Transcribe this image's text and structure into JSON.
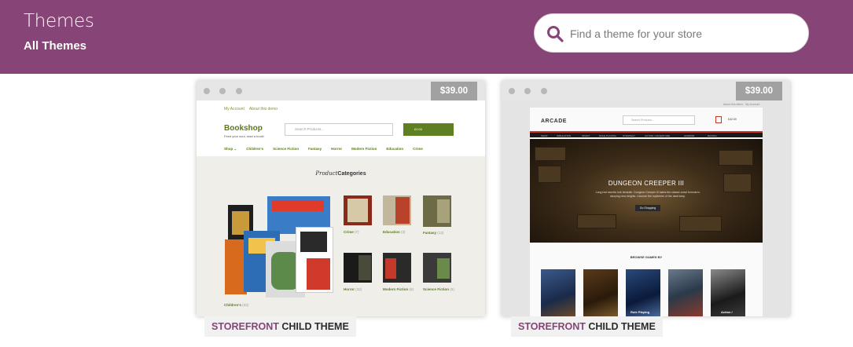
{
  "header": {
    "title": "Themes",
    "subtitle": "All Themes",
    "search_placeholder": "Find a theme for your store",
    "background": "#874476"
  },
  "cards": [
    {
      "price": "$39.00",
      "label_brand": "STOREFRONT",
      "label_rest": " CHILD THEME",
      "preview": {
        "top_links": [
          "My Account",
          "About this demo"
        ],
        "logo": "Bookshop",
        "tagline": "Feed your soul, read a book!",
        "search_placeholder": "Search Products...",
        "cart": "£0.00",
        "nav": [
          "Shop ⌄",
          "Children's",
          "Science Fiction",
          "Fantasy",
          "Horror",
          "Modern Fiction",
          "Education",
          "Crime"
        ],
        "heading_italic": "Product",
        "heading_bold": "Categories",
        "categories": [
          {
            "name": "Crime",
            "count": "(7)"
          },
          {
            "name": "Education",
            "count": "(3)"
          },
          {
            "name": "Fantasy",
            "count": "(13)"
          },
          {
            "name": "Horror",
            "count": "(32)"
          },
          {
            "name": "Modern Fiction",
            "count": "(6)"
          },
          {
            "name": "Science Fiction",
            "count": "(5)"
          },
          {
            "name": "Children's",
            "count": "(33)"
          }
        ]
      }
    },
    {
      "price": "$39.00",
      "label_brand": "STOREFRONT",
      "label_rest": " CHILD THEME",
      "preview": {
        "top_links": [
          "About this demo",
          "My Account"
        ],
        "logo": "ARCADE",
        "search_placeholder": "Search Products...",
        "cart": "£42.00",
        "nav": [
          "SHOP",
          "SIMULATION",
          "SPORT",
          "ROLE PLAYING",
          "STRATEGY",
          "ACTION / ADVENTURE",
          "HORROR",
          "RACING"
        ],
        "hero_title": "DUNGEON CREEPER III",
        "hero_text": "Long lost secrets lurk beneath. Dungeon Creeper III takes the classic crawl formula to dizzying new heights. Uncover the mysteries of the dark keep.",
        "hero_button": "Go Shopping",
        "browse_heading": "BROWSE GAMES BY",
        "thumbs": [
          "",
          "",
          "Role Playing",
          "",
          "Action /"
        ]
      }
    }
  ]
}
